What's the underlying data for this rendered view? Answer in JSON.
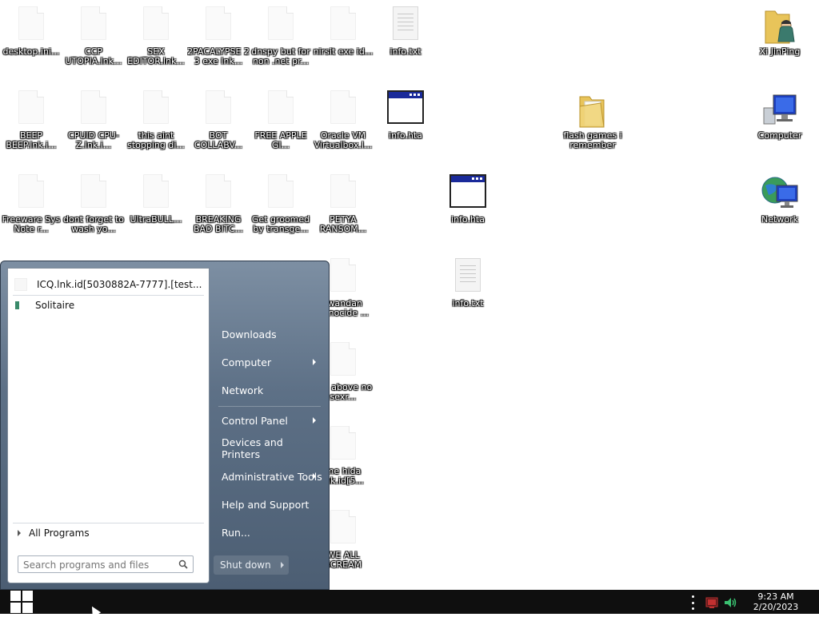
{
  "desktop": {
    "icons": [
      {
        "label": "desktop.ini...",
        "type": "blank"
      },
      {
        "label": "CCP UTOPIA.lnk...",
        "type": "blank"
      },
      {
        "label": "SEX EDITOR.lnk...",
        "type": "blank"
      },
      {
        "label": "2PACALYPSE 2 3 exe lnk...",
        "type": "blank"
      },
      {
        "label": "dnspy but for non .net pr...",
        "type": "blank"
      },
      {
        "label": "nirsit exe id...",
        "type": "blank"
      },
      {
        "label": "info.txt",
        "type": "text"
      },
      {
        "label": "Xi JinPing",
        "type": "user-folder"
      },
      {
        "label": "BEEP BEEP.lnk.i...",
        "type": "blank"
      },
      {
        "label": "CPUID CPU-Z.lnk.i...",
        "type": "blank"
      },
      {
        "label": "this aint stopping di...",
        "type": "blank"
      },
      {
        "label": "BOT COLLABV...",
        "type": "blank"
      },
      {
        "label": "FREE APPLE GI...",
        "type": "blank"
      },
      {
        "label": "Oracle VM Virtualbox.l...",
        "type": "blank"
      },
      {
        "label": "info.hta",
        "type": "hta"
      },
      {
        "label": "flash games i remember",
        "type": "folder"
      },
      {
        "label": "Computer",
        "type": "computer"
      },
      {
        "label": "Freeware Sys Note r...",
        "type": "blank"
      },
      {
        "label": "dont forget to wash yo...",
        "type": "blank"
      },
      {
        "label": "UltraBULL...",
        "type": "blank"
      },
      {
        "label": "BREAKING BAD BITC...",
        "type": "blank"
      },
      {
        "label": "Get groomed by transge...",
        "type": "blank"
      },
      {
        "label": "PETYA RANSOM...",
        "type": "blank"
      },
      {
        "label": "info.hta",
        "type": "hta"
      },
      {
        "label": "Network",
        "type": "network"
      },
      {
        "label": "rwandan genocide ...",
        "type": "blank"
      },
      {
        "label": "info.txt",
        "type": "text"
      },
      {
        "label": "the above no sexr...",
        "type": "blank"
      },
      {
        "label": "me hida lnk.id[5...",
        "type": "blank"
      },
      {
        "label": "WE ALL SCREAM",
        "type": "blank"
      }
    ]
  },
  "start_menu": {
    "recent_programs": [
      "ICQ.lnk.id[5030882A-7777].[test...",
      "Solitaire"
    ],
    "all_programs_label": "All Programs",
    "search_placeholder": "Search programs and files",
    "right_items": [
      {
        "label": "Downloads"
      },
      {
        "label": "Computer"
      },
      {
        "label": "Network"
      },
      {
        "label": "Control Panel"
      },
      {
        "label": "Devices and Printers"
      },
      {
        "label": "Administrative Tools"
      },
      {
        "label": "Help and Support"
      },
      {
        "label": "Run..."
      }
    ],
    "shutdown_label": "Shut down"
  },
  "taskbar": {
    "time": "9:23 AM",
    "date": "2/20/2023",
    "tray_icons": [
      "network-warning-icon",
      "volume-icon"
    ]
  }
}
